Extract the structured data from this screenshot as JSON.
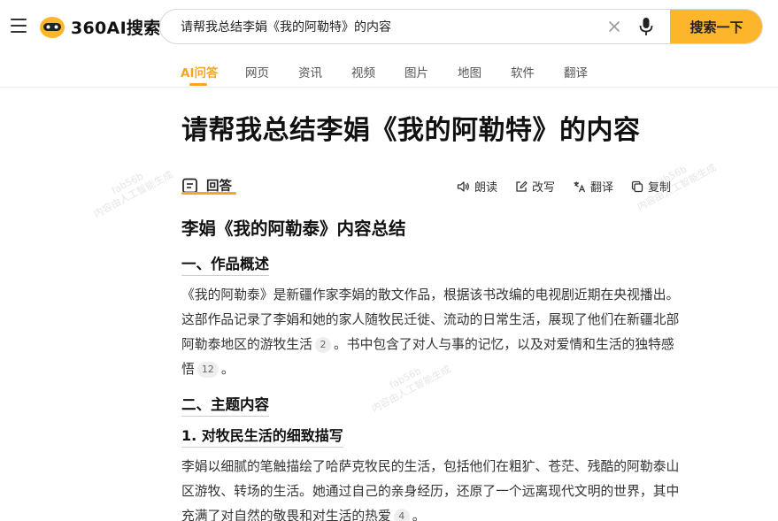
{
  "header": {
    "logo_text": "360AI搜索",
    "search_value": "请帮我总结李娟《我的阿勒特》的内容",
    "search_button": "搜索一下"
  },
  "tabs": [
    {
      "label": "AI问答",
      "active": true
    },
    {
      "label": "网页"
    },
    {
      "label": "资讯"
    },
    {
      "label": "视频"
    },
    {
      "label": "图片"
    },
    {
      "label": "地图"
    },
    {
      "label": "软件"
    },
    {
      "label": "翻译"
    }
  ],
  "main": {
    "title": "请帮我总结李娟《我的阿勒特》的内容",
    "answer_tab": "回答",
    "actions": [
      "朗读",
      "改写",
      "翻译",
      "复制"
    ],
    "heading": "李娟《我的阿勒泰》内容总结",
    "section1": {
      "title": "一、作品概述",
      "text_a": "《我的阿勒泰》是新疆作家李娟的散文作品，根据该书改编的电视剧近期在央视播出。这部作品记录了李娟和她的家人随牧民迁徙、流动的日常生活，展现了他们在新疆北部阿勒泰地区的游牧生活",
      "cite_a": "2",
      "text_b": "。书中包含了对人与事的记忆，以及对爱情和生活的独特感悟",
      "cite_b": "12",
      "text_c": "。"
    },
    "section2": {
      "title": "二、主题内容",
      "sub_title": "1. 对牧民生活的细致描写",
      "text_a": "李娟以细腻的笔触描绘了哈萨克牧民的生活，包括他们在粗犷、苍茫、残酷的阿勒泰山区游牧、转场的生活。她通过自己的亲身经历，还原了一个远离现代文明的世界，其中充满了对自然的敬畏和对生活的热爱",
      "cite_a": "4",
      "text_b": "。"
    }
  },
  "watermark": {
    "line1": "fab56b",
    "line2": "内容由人工智能生成"
  },
  "colors": {
    "accent": "#f5a623",
    "search_button": "#fdb52b"
  }
}
